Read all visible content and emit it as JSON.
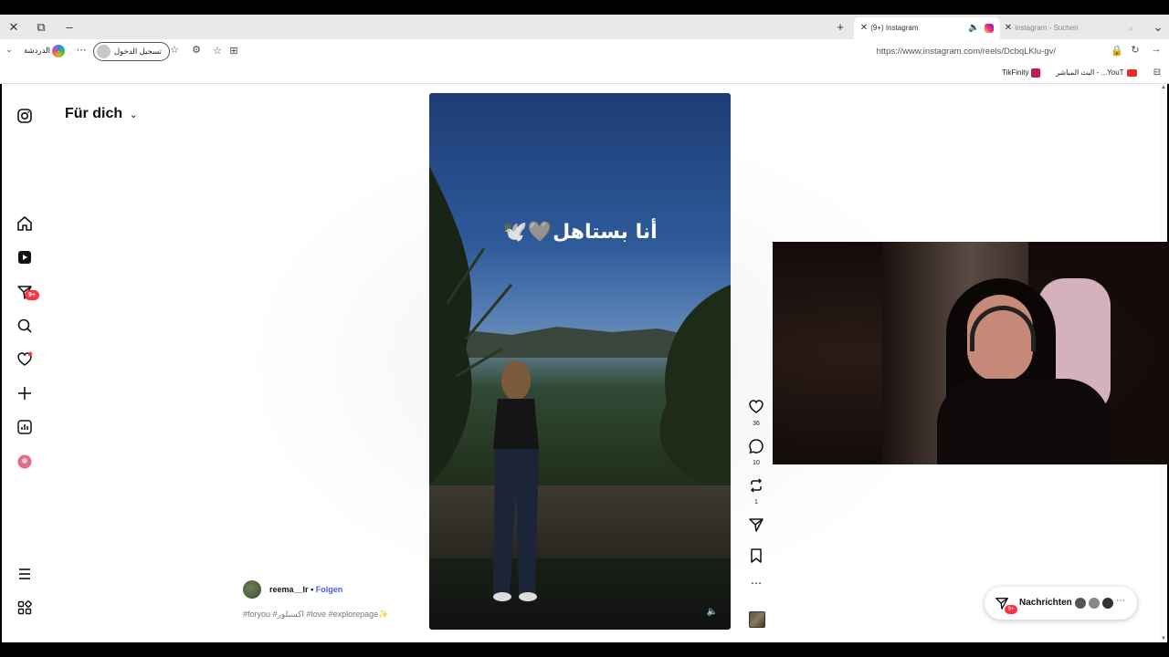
{
  "browser": {
    "tabs": [
      {
        "label": "(9+) Instagram",
        "active": true
      },
      {
        "label": "instagram - Suchen",
        "active": false
      }
    ],
    "url": "https://www.instagram.com/reels/DcbqLKlu-gv/",
    "signin_label": "تسجيل الدخول",
    "chat_label": "الدردشة",
    "bookmarks": [
      {
        "label": "TikFinity",
        "icon": "tikfinity-icon"
      },
      {
        "label": "البث المباشر - ...YouT",
        "icon": "youtube-icon"
      }
    ]
  },
  "sidebar": {
    "feed_title": "Für dich",
    "notifications_badge": "9+",
    "items": [
      {
        "name": "home-icon"
      },
      {
        "name": "reels-icon"
      },
      {
        "name": "messages-icon"
      },
      {
        "name": "search-icon"
      },
      {
        "name": "notifications-icon"
      },
      {
        "name": "create-icon"
      },
      {
        "name": "dashboard-icon"
      },
      {
        "name": "threads-icon"
      }
    ]
  },
  "reel": {
    "overlay_text": "أنا بستاهل🩶🕊️",
    "author": "reema__lr",
    "separator": "•",
    "follow_label": "Folgen",
    "caption": "#foryou #اكسبلور #love #explorepage✨",
    "likes": "36",
    "comments": "10",
    "reposts": "1"
  },
  "messages": {
    "label": "Nachrichten",
    "badge": "9+"
  },
  "colors": {
    "accent": "#4a5df0",
    "badge": "#ff3040"
  }
}
